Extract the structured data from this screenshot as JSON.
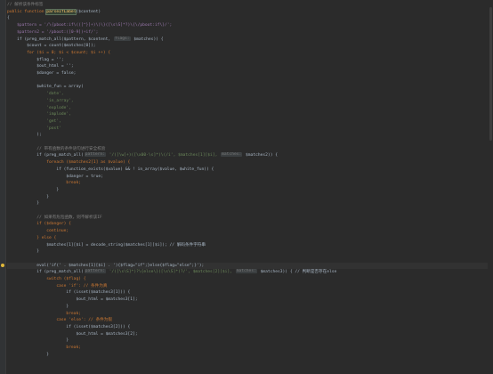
{
  "editor": {
    "lines": [
      {
        "segments": [
          {
            "t": "// 解析该条件标签",
            "c": "#808080"
          }
        ]
      },
      {
        "segments": [
          {
            "t": "public function ",
            "c": "#cc7832"
          },
          {
            "t": "parseIfLabel",
            "c": "#ffc66d",
            "hl": true
          },
          {
            "t": "($content)",
            "c": "#a9b7c6"
          }
        ]
      },
      {
        "segments": [
          {
            "t": "{",
            "c": "#a9b7c6"
          }
        ]
      },
      {
        "segments": [
          {
            "t": "    $pattern = '/\\{pboot:if\\(([^}]+)\\)\\}([\\s\\S]*?)\\{\\/pboot:if\\}/';",
            "c": "#9876aa"
          }
        ]
      },
      {
        "segments": [
          {
            "t": "    $pattern2 = '/pboot:([0-9])+if/';",
            "c": "#9876aa"
          }
        ]
      },
      {
        "segments": [
          {
            "t": "    if (preg_match_all($pattern, $content, ",
            "c": "#a9b7c6"
          },
          {
            "t": "flags:",
            "hint": true
          },
          {
            "t": " $matches)) {",
            "c": "#a9b7c6"
          }
        ]
      },
      {
        "segments": [
          {
            "t": "        $count = count($matches[0]);",
            "c": "#a9b7c6"
          }
        ]
      },
      {
        "segments": [
          {
            "t": "        for ($i = 0; $i < $count; $i ++) {",
            "c": "#cc7832"
          }
        ]
      },
      {
        "segments": [
          {
            "t": "            $flag = '';",
            "c": "#a9b7c6"
          }
        ]
      },
      {
        "segments": [
          {
            "t": "            $out_html = '';",
            "c": "#a9b7c6"
          }
        ]
      },
      {
        "segments": [
          {
            "t": "            $danger = false;",
            "c": "#a9b7c6"
          }
        ]
      },
      {
        "segments": [
          {
            "t": "",
            "c": "#a9b7c6"
          }
        ]
      },
      {
        "segments": [
          {
            "t": "            $white_fun = array(",
            "c": "#a9b7c6"
          }
        ]
      },
      {
        "segments": [
          {
            "t": "                'date',",
            "c": "#6a8759"
          }
        ]
      },
      {
        "segments": [
          {
            "t": "                'in_array',",
            "c": "#6a8759"
          }
        ]
      },
      {
        "segments": [
          {
            "t": "                'explode',",
            "c": "#6a8759"
          }
        ]
      },
      {
        "segments": [
          {
            "t": "                'implode',",
            "c": "#6a8759"
          }
        ]
      },
      {
        "segments": [
          {
            "t": "                'get',",
            "c": "#6a8759"
          }
        ]
      },
      {
        "segments": [
          {
            "t": "                'post'",
            "c": "#6a8759"
          }
        ]
      },
      {
        "segments": [
          {
            "t": "            );",
            "c": "#a9b7c6"
          }
        ]
      },
      {
        "segments": [
          {
            "t": "",
            "c": "#a9b7c6"
          }
        ]
      },
      {
        "segments": [
          {
            "t": "            // 带有函数的条件语句进行安全校验",
            "c": "#808080"
          }
        ]
      },
      {
        "segments": [
          {
            "t": "            if (preg_match_all(",
            "c": "#a9b7c6"
          },
          {
            "t": "pattern:",
            "hint": true
          },
          {
            "t": " '/([\\w]+)([\\x00-\\s]*)\\(/i', $matches[1][$i], ",
            "c": "#6a8759"
          },
          {
            "t": "matches:",
            "hint": true
          },
          {
            "t": " $matches2)) {",
            "c": "#a9b7c6"
          }
        ]
      },
      {
        "segments": [
          {
            "t": "                foreach ($matches2[1] as $value) {",
            "c": "#cc7832"
          }
        ]
      },
      {
        "segments": [
          {
            "t": "                    if (function_exists($value) && ! in_array($value, $white_fun)) {",
            "c": "#a9b7c6"
          }
        ]
      },
      {
        "segments": [
          {
            "t": "                        $danger = true;",
            "c": "#a9b7c6"
          }
        ]
      },
      {
        "segments": [
          {
            "t": "                        break;",
            "c": "#cc7832"
          }
        ]
      },
      {
        "segments": [
          {
            "t": "                    }",
            "c": "#a9b7c6"
          }
        ]
      },
      {
        "segments": [
          {
            "t": "                }",
            "c": "#a9b7c6"
          }
        ]
      },
      {
        "segments": [
          {
            "t": "            }",
            "c": "#a9b7c6"
          }
        ]
      },
      {
        "segments": [
          {
            "t": "",
            "c": "#a9b7c6"
          }
        ]
      },
      {
        "segments": [
          {
            "t": "            // 如果有危险函数，则不解析该IF",
            "c": "#808080"
          }
        ]
      },
      {
        "segments": [
          {
            "t": "            if ($danger) {",
            "c": "#cc7832"
          }
        ]
      },
      {
        "segments": [
          {
            "t": "                continue;",
            "c": "#cc7832"
          }
        ]
      },
      {
        "segments": [
          {
            "t": "            } else {",
            "c": "#cc7832"
          }
        ]
      },
      {
        "segments": [
          {
            "t": "                $matches[1][$i] = decode_string($matches[1][$i]); // 解码条件字符串",
            "c": "#a9b7c6"
          }
        ]
      },
      {
        "segments": [
          {
            "t": "            }",
            "c": "#a9b7c6"
          }
        ]
      },
      {
        "segments": [
          {
            "t": "",
            "c": "#a9b7c6"
          }
        ]
      },
      {
        "segments": [
          {
            "t": "            eval('if(' . $matches[1][$i] . '){$flag=\"if\";}else{$flag=\"else\";}');",
            "c": "#a9b7c6"
          }
        ],
        "caret": true,
        "bulb": true
      },
      {
        "segments": [
          {
            "t": "            if (preg_match_all(",
            "c": "#a9b7c6"
          },
          {
            "t": "pattern:",
            "hint": true
          },
          {
            "t": " '/([\\s\\S]*)?\\{else\\}([\\s\\S]*)?/', $matches[2][$i], ",
            "c": "#6a8759"
          },
          {
            "t": "matches:",
            "hint": true
          },
          {
            "t": " $matches3)) { // 判断是否存在else",
            "c": "#a9b7c6"
          }
        ]
      },
      {
        "segments": [
          {
            "t": "                switch ($flag) {",
            "c": "#cc7832"
          }
        ]
      },
      {
        "segments": [
          {
            "t": "                    case 'if': // 条件为真",
            "c": "#cc7832"
          }
        ]
      },
      {
        "segments": [
          {
            "t": "                        if (isset($matches3[1])) {",
            "c": "#a9b7c6"
          }
        ]
      },
      {
        "segments": [
          {
            "t": "                            $out_html = $matches3[1];",
            "c": "#a9b7c6"
          }
        ]
      },
      {
        "segments": [
          {
            "t": "                        }",
            "c": "#a9b7c6"
          }
        ]
      },
      {
        "segments": [
          {
            "t": "                        break;",
            "c": "#cc7832"
          }
        ]
      },
      {
        "segments": [
          {
            "t": "                    case 'else': // 条件为假",
            "c": "#cc7832"
          }
        ]
      },
      {
        "segments": [
          {
            "t": "                        if (isset($matches3[2])) {",
            "c": "#a9b7c6"
          }
        ]
      },
      {
        "segments": [
          {
            "t": "                            $out_html = $matches3[2];",
            "c": "#a9b7c6"
          }
        ]
      },
      {
        "segments": [
          {
            "t": "                        }",
            "c": "#a9b7c6"
          }
        ]
      },
      {
        "segments": [
          {
            "t": "                        break;",
            "c": "#cc7832"
          }
        ]
      },
      {
        "segments": [
          {
            "t": "                }",
            "c": "#a9b7c6"
          }
        ]
      }
    ]
  }
}
